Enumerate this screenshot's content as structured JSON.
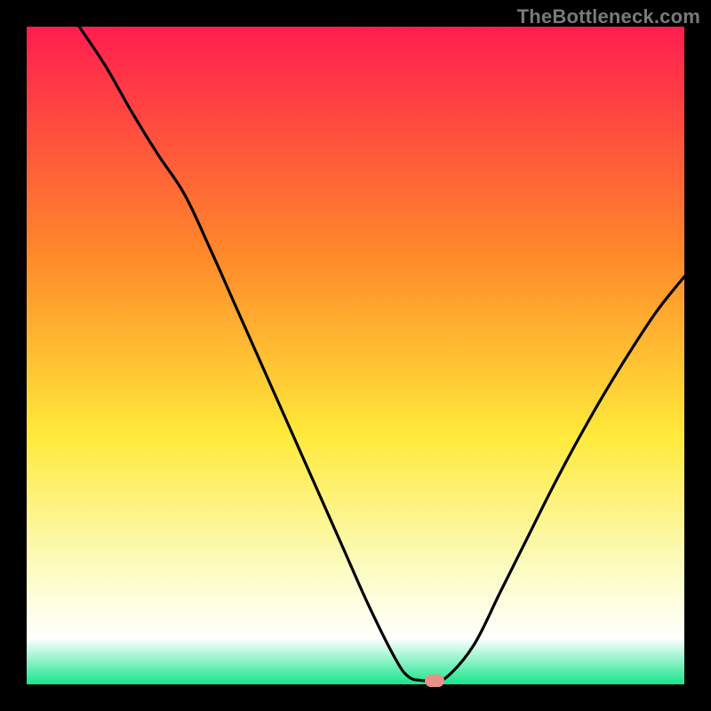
{
  "watermark": "TheBottleneck.com",
  "colors": {
    "top": "#ff1d4f",
    "orange": "#ff8a2a",
    "yellow": "#ffe93a",
    "pale_yellow": "#fcfbbf",
    "white": "#ffffff",
    "green": "#17e58b",
    "curve": "#000000",
    "background": "#000000",
    "marker": "#e99088"
  },
  "chart_data": {
    "type": "line",
    "title": "",
    "xlabel": "",
    "ylabel": "",
    "xlim": [
      0,
      100
    ],
    "ylim": [
      0,
      100
    ],
    "x": [
      8,
      12,
      16,
      20,
      24,
      28,
      32,
      36,
      40,
      44,
      48,
      52,
      56,
      58,
      60,
      62,
      64,
      68,
      72,
      76,
      80,
      84,
      88,
      92,
      96,
      100
    ],
    "values": [
      100,
      94,
      87,
      80.5,
      74.5,
      66,
      57,
      48,
      39,
      30,
      21,
      12,
      4,
      1.2,
      0.6,
      0.6,
      1.2,
      6,
      14,
      22,
      30,
      37.5,
      44.5,
      51,
      57,
      62
    ],
    "marker": {
      "x": 62,
      "y": 0.6
    },
    "notes": "Bottleneck-style curve: steep descent from top-left to a minimum near x≈61, short flat valley, then rise to upper-right. Background is a vertical red→orange→yellow→pale→green gradient."
  }
}
